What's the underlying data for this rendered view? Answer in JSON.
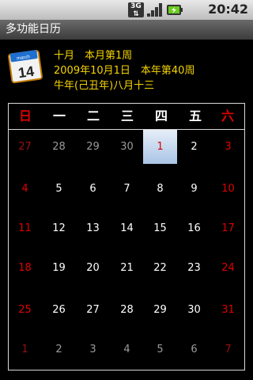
{
  "status": {
    "time": "20:42",
    "network_label": "3G"
  },
  "title": "多功能日历",
  "icon": {
    "month": "march",
    "day": "14"
  },
  "info": {
    "line1": "十月　本月第1周",
    "line2": "2009年10月1日　本年第40周",
    "line3": "牛年(己丑年)八月十三"
  },
  "weekdays": [
    "日",
    "一",
    "二",
    "三",
    "四",
    "五",
    "六"
  ],
  "weeks": [
    [
      "27",
      "28",
      "29",
      "30",
      "1",
      "2",
      "3"
    ],
    [
      "4",
      "5",
      "6",
      "7",
      "8",
      "9",
      "10"
    ],
    [
      "11",
      "12",
      "13",
      "14",
      "15",
      "16",
      "17"
    ],
    [
      "18",
      "19",
      "20",
      "21",
      "22",
      "23",
      "24"
    ],
    [
      "25",
      "26",
      "27",
      "28",
      "29",
      "30",
      "31"
    ],
    [
      "1",
      "2",
      "3",
      "4",
      "5",
      "6",
      "7"
    ]
  ],
  "colors": {
    "accent": "#f5d400",
    "weekend": "#e00000",
    "today_bg": "#a9c4e6"
  }
}
